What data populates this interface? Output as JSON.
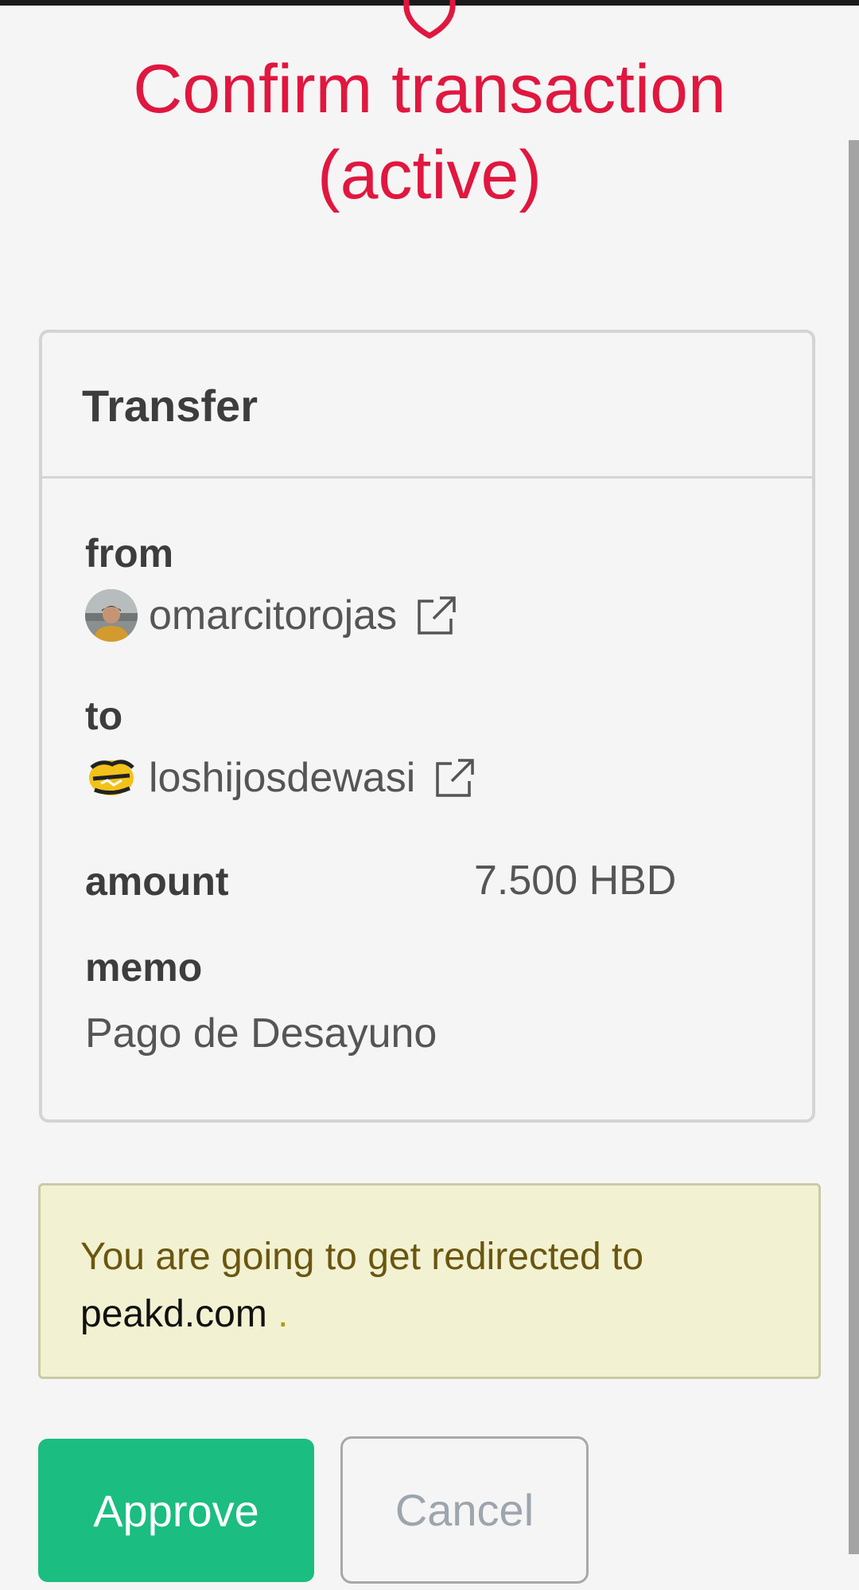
{
  "header": {
    "title": "Confirm transaction (active)",
    "icon": "shield-icon",
    "title_color": "#e0173f"
  },
  "transaction": {
    "type": "Transfer",
    "from_label": "from",
    "from_account": "omarcitorojas",
    "to_label": "to",
    "to_account": "loshijosdewasi",
    "amount_label": "amount",
    "amount_value": "7.500 HBD",
    "memo_label": "memo",
    "memo_value": "Pago de Desayuno"
  },
  "notice": {
    "text": "You are going to get redirected to",
    "domain": "peakd.com",
    "trailing": "."
  },
  "actions": {
    "approve_label": "Approve",
    "cancel_label": "Cancel",
    "approve_color": "#1bbd80"
  },
  "to_avatar_logo": "Los Hijos de Wasi"
}
